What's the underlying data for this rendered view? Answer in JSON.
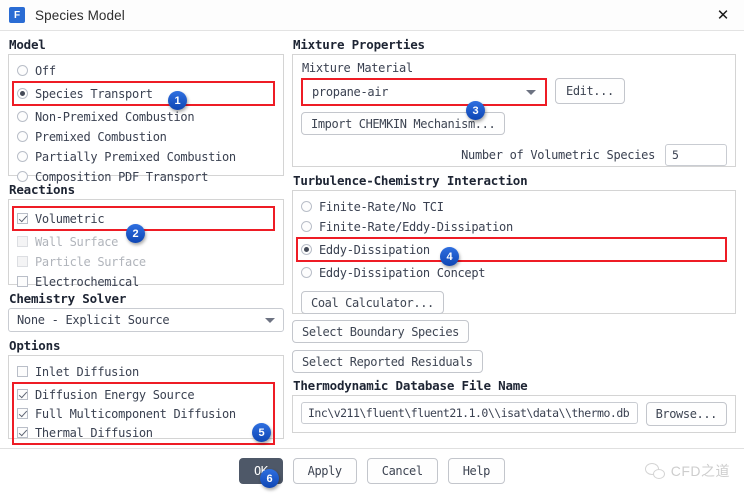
{
  "window": {
    "title": "Species Model",
    "app_icon": "fluent-f-icon",
    "close_icon": "close-icon"
  },
  "model": {
    "group_label": "Model",
    "options": [
      {
        "label": "Off",
        "selected": false
      },
      {
        "label": "Species Transport",
        "selected": true,
        "highlight": true,
        "badge": "1"
      },
      {
        "label": "Non-Premixed Combustion",
        "selected": false
      },
      {
        "label": "Premixed Combustion",
        "selected": false
      },
      {
        "label": "Partially Premixed Combustion",
        "selected": false
      },
      {
        "label": "Composition PDF Transport",
        "selected": false
      }
    ]
  },
  "reactions": {
    "group_label": "Reactions",
    "options": [
      {
        "label": "Volumetric",
        "checked": true,
        "disabled": false,
        "highlight": true,
        "badge": "2"
      },
      {
        "label": "Wall Surface",
        "checked": false,
        "disabled": true
      },
      {
        "label": "Particle Surface",
        "checked": false,
        "disabled": true
      },
      {
        "label": "Electrochemical",
        "checked": false,
        "disabled": false
      }
    ]
  },
  "chemistry_solver": {
    "group_label": "Chemistry Solver",
    "selected": "None - Explicit Source",
    "dropdown_icon": "chevron-down-icon"
  },
  "options_panel": {
    "group_label": "Options",
    "badge": "5",
    "options": [
      {
        "label": "Inlet Diffusion",
        "checked": false,
        "highlight": false
      },
      {
        "label": "Diffusion Energy Source",
        "checked": true,
        "highlight": true
      },
      {
        "label": "Full Multicomponent Diffusion",
        "checked": true,
        "highlight": true
      },
      {
        "label": "Thermal Diffusion",
        "checked": true,
        "highlight": true
      }
    ]
  },
  "mixture_properties": {
    "group_label": "Mixture Properties",
    "material_caption": "Mixture Material",
    "material_value": "propane-air",
    "material_badge": "3",
    "dropdown_icon": "chevron-down-icon",
    "edit_button": "Edit...",
    "import_button": "Import CHEMKIN Mechanism...",
    "species_caption": "Number of Volumetric Species",
    "species_value": "5"
  },
  "turbulence_chemistry": {
    "group_label": "Turbulence-Chemistry Interaction",
    "options": [
      {
        "label": "Finite-Rate/No TCI",
        "selected": false
      },
      {
        "label": "Finite-Rate/Eddy-Dissipation",
        "selected": false
      },
      {
        "label": "Eddy-Dissipation",
        "selected": true,
        "highlight": true,
        "badge": "4"
      },
      {
        "label": "Eddy-Dissipation Concept",
        "selected": false
      }
    ],
    "coal_button": "Coal Calculator..."
  },
  "right_actions": {
    "boundary_species_button": "Select Boundary Species",
    "reported_residuals_button": "Select Reported Residuals"
  },
  "thermo_db": {
    "group_label": "Thermodynamic Database File Name",
    "path": "Inc\\v211\\fluent\\fluent21.1.0\\\\isat\\data\\\\thermo.db",
    "browse_button": "Browse..."
  },
  "footer": {
    "ok_button": "OK",
    "ok_badge": "6",
    "apply_button": "Apply",
    "cancel_button": "Cancel",
    "help_button": "Help",
    "watermark_text": "CFD之道",
    "watermark_icon": "wechat-icon"
  },
  "colors": {
    "highlight_red": "#ee1c25",
    "badge_blue": "#1553c6",
    "accent_icon_blue": "#2a6cd4"
  }
}
